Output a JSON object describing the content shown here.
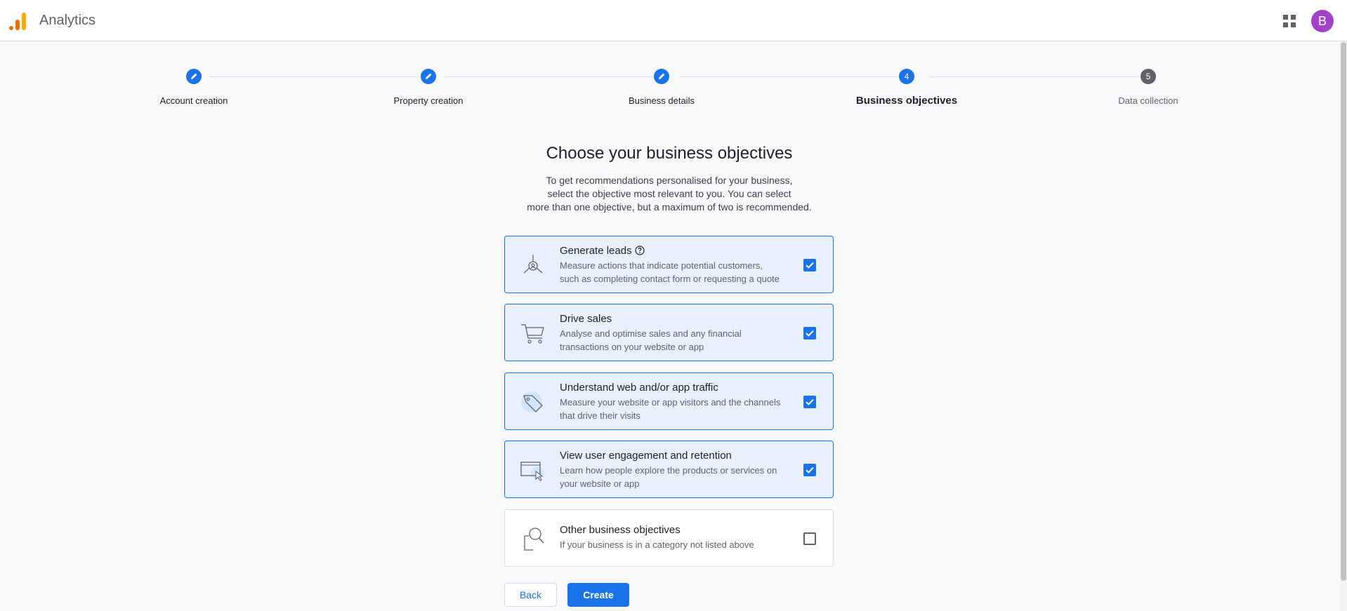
{
  "header": {
    "app_title": "Analytics",
    "apps_icon": "apps-grid-icon",
    "avatar_initial": "B"
  },
  "stepper": {
    "steps": [
      {
        "label": "Account creation",
        "status": "done",
        "icon": "edit-pencil-icon"
      },
      {
        "label": "Property creation",
        "status": "done",
        "icon": "edit-pencil-icon"
      },
      {
        "label": "Business details",
        "status": "done",
        "icon": "edit-pencil-icon"
      },
      {
        "number": "4",
        "label": "Business objectives",
        "status": "current"
      },
      {
        "number": "5",
        "label": "Data collection",
        "status": "upcoming"
      }
    ]
  },
  "main": {
    "heading": "Choose your business objectives",
    "subtitle_lines": [
      "To get recommendations personalised for your business,",
      "select the objective most relevant to you. You can select",
      "more than one objective, but a maximum of two is recommended."
    ],
    "objectives": [
      {
        "title": "Generate leads",
        "desc_lines": [
          "Measure actions that indicate potential customers,",
          "such as completing contact form or requesting a quote"
        ],
        "checked": true,
        "icon": "leads-target-icon",
        "has_help": true
      },
      {
        "title": "Drive sales",
        "desc_lines": [
          "Analyse and optimise sales and any financial",
          "transactions on your website or app"
        ],
        "checked": true,
        "icon": "shopping-cart-icon"
      },
      {
        "title": "Understand web and/or app traffic",
        "desc_lines": [
          "Measure your website or app visitors and the channels",
          "that drive their visits"
        ],
        "checked": true,
        "icon": "tag-icon"
      },
      {
        "title": "View user engagement and retention",
        "desc_lines": [
          "Learn how people explore the products or services on",
          "your website or app"
        ],
        "checked": true,
        "icon": "browser-cursor-icon"
      },
      {
        "title": "Other business objectives",
        "desc_lines": [
          "If your business is in a category not listed above"
        ],
        "checked": false,
        "icon": "magnifier-document-icon"
      }
    ],
    "back_label": "Back",
    "create_label": "Create"
  },
  "colors": {
    "accent": "#1a73e8",
    "selected_bg": "#e8f0fe",
    "avatar": "#a142c9",
    "logo_orange": "#f9ab00",
    "logo_dark": "#e37400"
  }
}
